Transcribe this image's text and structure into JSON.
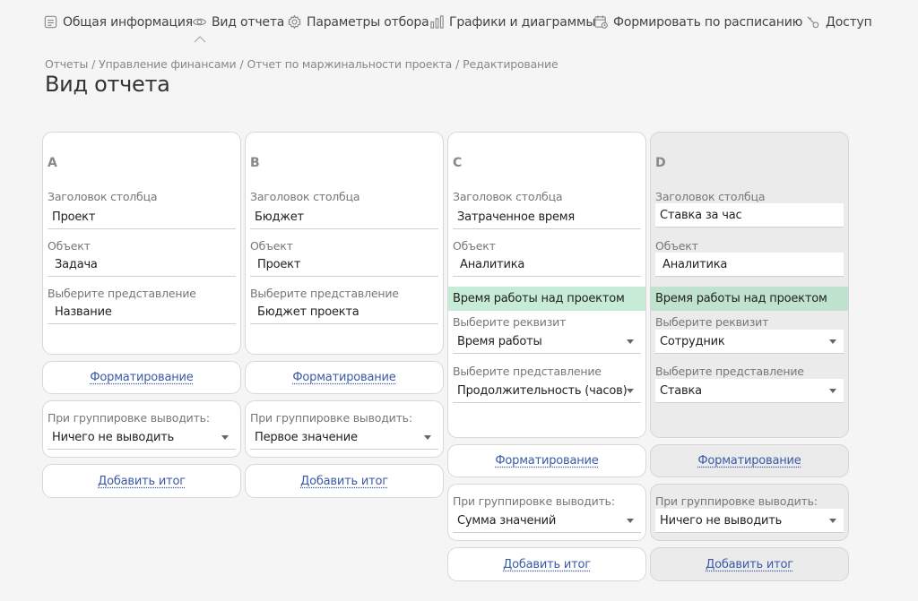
{
  "nav": {
    "items": [
      {
        "label": "Общая информация",
        "icon": "document-icon"
      },
      {
        "label": "Вид отчета",
        "icon": "eye-icon"
      },
      {
        "label": "Параметры отбора",
        "icon": "gear-icon"
      },
      {
        "label": "Графики и диаграммы",
        "icon": "bar-chart-icon"
      },
      {
        "label": "Формировать по расписанию",
        "icon": "calendar-clock-icon"
      },
      {
        "label": "Доступ",
        "icon": "key-icon"
      }
    ],
    "active": "Вид отчета"
  },
  "breadcrumb": [
    "Отчеты",
    "Управление финансами",
    "Отчет по маржинальности проекта",
    "Редактирование"
  ],
  "breadcrumb_separator": "/",
  "page_title": "Вид отчета",
  "columns": [
    {
      "letter": "A",
      "header_label": "Заголовок столбца",
      "header_value": "Проект",
      "object_label": "Объект",
      "object_value": "Задача",
      "view_label": "Выберите представление",
      "view_value": "Название",
      "format_link": "Форматирование",
      "group_label": "При группировке выводить:",
      "group_value": "Ничего не выводить",
      "add_total": "Добавить итог"
    },
    {
      "letter": "B",
      "header_label": "Заголовок столбца",
      "header_value": "Бюджет",
      "object_label": "Объект",
      "object_value": "Проект",
      "view_label": "Выберите представление",
      "view_value": "Бюджет проекта",
      "format_link": "Форматирование",
      "group_label": "При группировке выводить:",
      "group_value": "Первое значение",
      "add_total": "Добавить итог"
    },
    {
      "letter": "C",
      "header_label": "Заголовок столбца",
      "header_value": "Затраченное время",
      "object_label": "Объект",
      "object_value": "Аналитика",
      "analytics_name": "Время работы над проектом",
      "attr_label": "Выберите реквизит",
      "attr_value": "Время работы",
      "view_label": "Выберите представление",
      "view_value": "Продолжительность (часов)",
      "format_link": "Форматирование",
      "group_label": "При группировке выводить:",
      "group_value": "Сумма значений",
      "add_total": "Добавить итог"
    },
    {
      "letter": "D",
      "header_label": "Заголовок столбца",
      "header_value": "Ставка за час",
      "object_label": "Объект",
      "object_value": "Аналитика",
      "analytics_name": "Время работы над проектом",
      "attr_label": "Выберите реквизит",
      "attr_value": "Сотрудник",
      "view_label": "Выберите представление",
      "view_value": "Ставка",
      "format_link": "Форматирование",
      "group_label": "При группировке выводить:",
      "group_value": "Ничего не выводить",
      "add_total": "Добавить итог"
    }
  ],
  "colors": {
    "background": "#f5f5f5",
    "card": "#ffffff",
    "card_selected": "#ebebeb",
    "analytics_band": "#c6ebd6",
    "link": "#3a5aa6"
  }
}
